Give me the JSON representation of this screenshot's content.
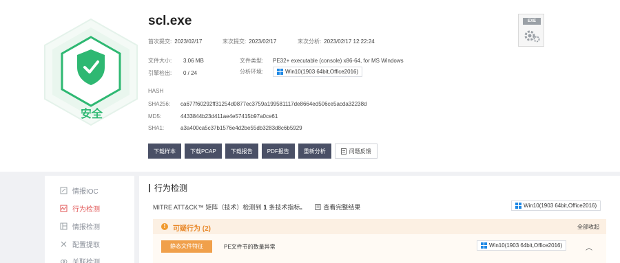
{
  "file": {
    "name": "scl.exe",
    "verdict": "安全",
    "first_submit_label": "首次提交:",
    "first_submit": "2023/02/17",
    "last_submit_label": "末次提交:",
    "last_submit": "2023/02/17",
    "last_analysis_label": "末次分析:",
    "last_analysis": "2023/02/17 12:22:24",
    "size_label": "文件大小:",
    "size": "3.06 MB",
    "type_label": "文件类型:",
    "type": "PE32+ executable (console) x86-64, for MS Windows",
    "engine_label": "引擎检出:",
    "engine": "0 / 24",
    "env_label": "分析环境:",
    "env": "Win10(1903 64bit,Office2016)",
    "thumb_label": "EXE"
  },
  "hash": {
    "heading": "HASH",
    "sha256_label": "SHA256:",
    "sha256": "ca677f60292ff31254d0877ec3759a199581117de8664ed506ce5acda32238d",
    "md5_label": "MD5:",
    "md5": "4433844b23d411ae4e57415b97a0ce61",
    "sha1_label": "SHA1:",
    "sha1": "a3a400ca5c37b1576e4d2be55db3283d8c6b5929"
  },
  "actions": {
    "download_sample": "下载样本",
    "download_pcap": "下载PCAP",
    "download_report": "下载报告",
    "pdf_report": "PDF报告",
    "reanalyze": "重新分析",
    "feedback": "问题反馈"
  },
  "nav": {
    "items": [
      {
        "label": "情报IOC",
        "icon": "ioc-icon"
      },
      {
        "label": "行为检测",
        "icon": "behavior-icon"
      },
      {
        "label": "情报检测",
        "icon": "intel-icon"
      },
      {
        "label": "配置提取",
        "icon": "tools-icon"
      },
      {
        "label": "关联检测",
        "icon": "link-icon"
      }
    ]
  },
  "behavior": {
    "title": "行为检测",
    "mitre_prefix": "MITRE ATT&CK™ 矩阵（技术）检测到",
    "mitre_count": "1",
    "mitre_suffix": "条技术指标。",
    "view_full": "查看完整结果",
    "env": "Win10(1903 64bit,Office2016)",
    "alert_title": "可疑行为",
    "alert_count": "(2)",
    "collapse_all": "全部收起",
    "item_tag": "静态文件特征",
    "item_text": "PE文件节的数量异常",
    "item_env": "Win10(1903 64bit,Office2016)"
  },
  "colors": {
    "safe_green": "#2eb872",
    "dark_button": "#4a5066",
    "alert_orange": "#f09a2f",
    "active_red": "#e05252"
  }
}
